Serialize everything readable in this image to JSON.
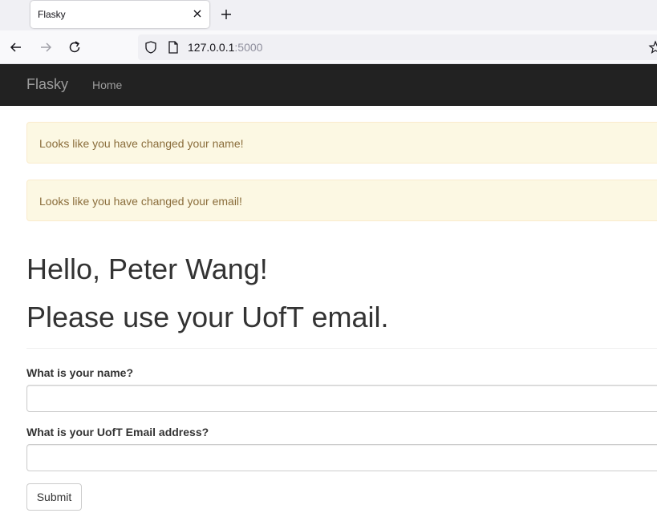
{
  "browser": {
    "tab_title": "Flasky",
    "url_host": "127.0.0.1",
    "url_port": ":5000"
  },
  "navbar": {
    "brand": "Flasky",
    "links": [
      "Home"
    ]
  },
  "alerts": [
    "Looks like you have changed your name!",
    "Looks like you have changed your email!"
  ],
  "page": {
    "greeting": "Hello, Peter Wang!",
    "notice": "Please use your UofT email."
  },
  "form": {
    "name_label": "What is your name?",
    "name_value": "",
    "email_label": "What is your UofT Email address?",
    "email_value": "",
    "submit_label": "Submit"
  },
  "colors": {
    "navbar_bg": "#222222",
    "alert_bg": "#fcf8e3",
    "alert_text": "#8a6d3b"
  }
}
